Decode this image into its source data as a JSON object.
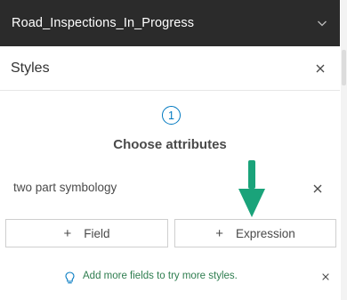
{
  "layer": {
    "title": "Road_Inspections_In_Progress",
    "expand_icon": "chevron-down-icon"
  },
  "panel": {
    "title": "Styles",
    "close_icon": "close-icon"
  },
  "step": {
    "number": "1",
    "title": "Choose attributes"
  },
  "attributes": [
    {
      "label": "two part symbology",
      "remove_icon": "close-icon"
    }
  ],
  "buttons": {
    "field_label": "Field",
    "expression_label": "Expression",
    "plus_glyph": "+"
  },
  "tip": {
    "text": "Add more fields to try more styles.",
    "icon": "lightbulb-icon",
    "dismiss_icon": "close-icon"
  },
  "colors": {
    "header_bg": "#2b2b2b",
    "accent_blue": "#0079c1",
    "annotation_green": "#1aa37a",
    "tip_green": "#2e7d4f"
  }
}
